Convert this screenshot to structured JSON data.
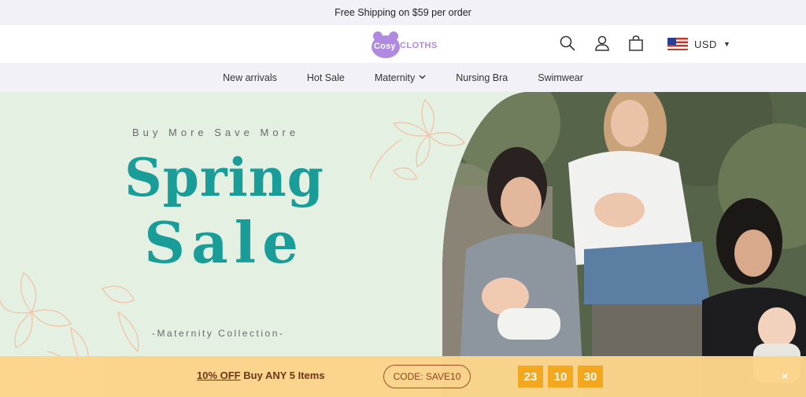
{
  "announcement": {
    "text": "Free Shipping on $59 per order"
  },
  "header": {
    "logo": {
      "cosy": "Cosy",
      "cloths": "CLOTHS"
    },
    "icons": [
      "search-icon",
      "user-icon",
      "shopping-bag-icon"
    ],
    "currency": {
      "label": "USD",
      "flag": "us-flag"
    }
  },
  "nav": {
    "items": [
      {
        "label": "New arrivals"
      },
      {
        "label": "Hot Sale"
      },
      {
        "label": "Maternity"
      },
      {
        "label": "Nursing Bra"
      },
      {
        "label": "Swimwear"
      }
    ]
  },
  "hero": {
    "subtitle": "Buy More Save More",
    "title_line1": "Spring",
    "title_line2": "Sale",
    "collection": "-Maternity Collection-"
  },
  "promo": {
    "discount": "10% OFF",
    "offer": "Buy ANY 5 Items",
    "code_label": "CODE: SAVE10",
    "countdown": [
      "23",
      "10",
      "30"
    ],
    "close": "×"
  },
  "colors": {
    "accent_teal": "#1a9d99",
    "brand_purple": "#b089e0",
    "promo_bg": "#fcd58c",
    "countdown_bg": "#f7a91c",
    "hero_bg": "#e4f0e2"
  }
}
